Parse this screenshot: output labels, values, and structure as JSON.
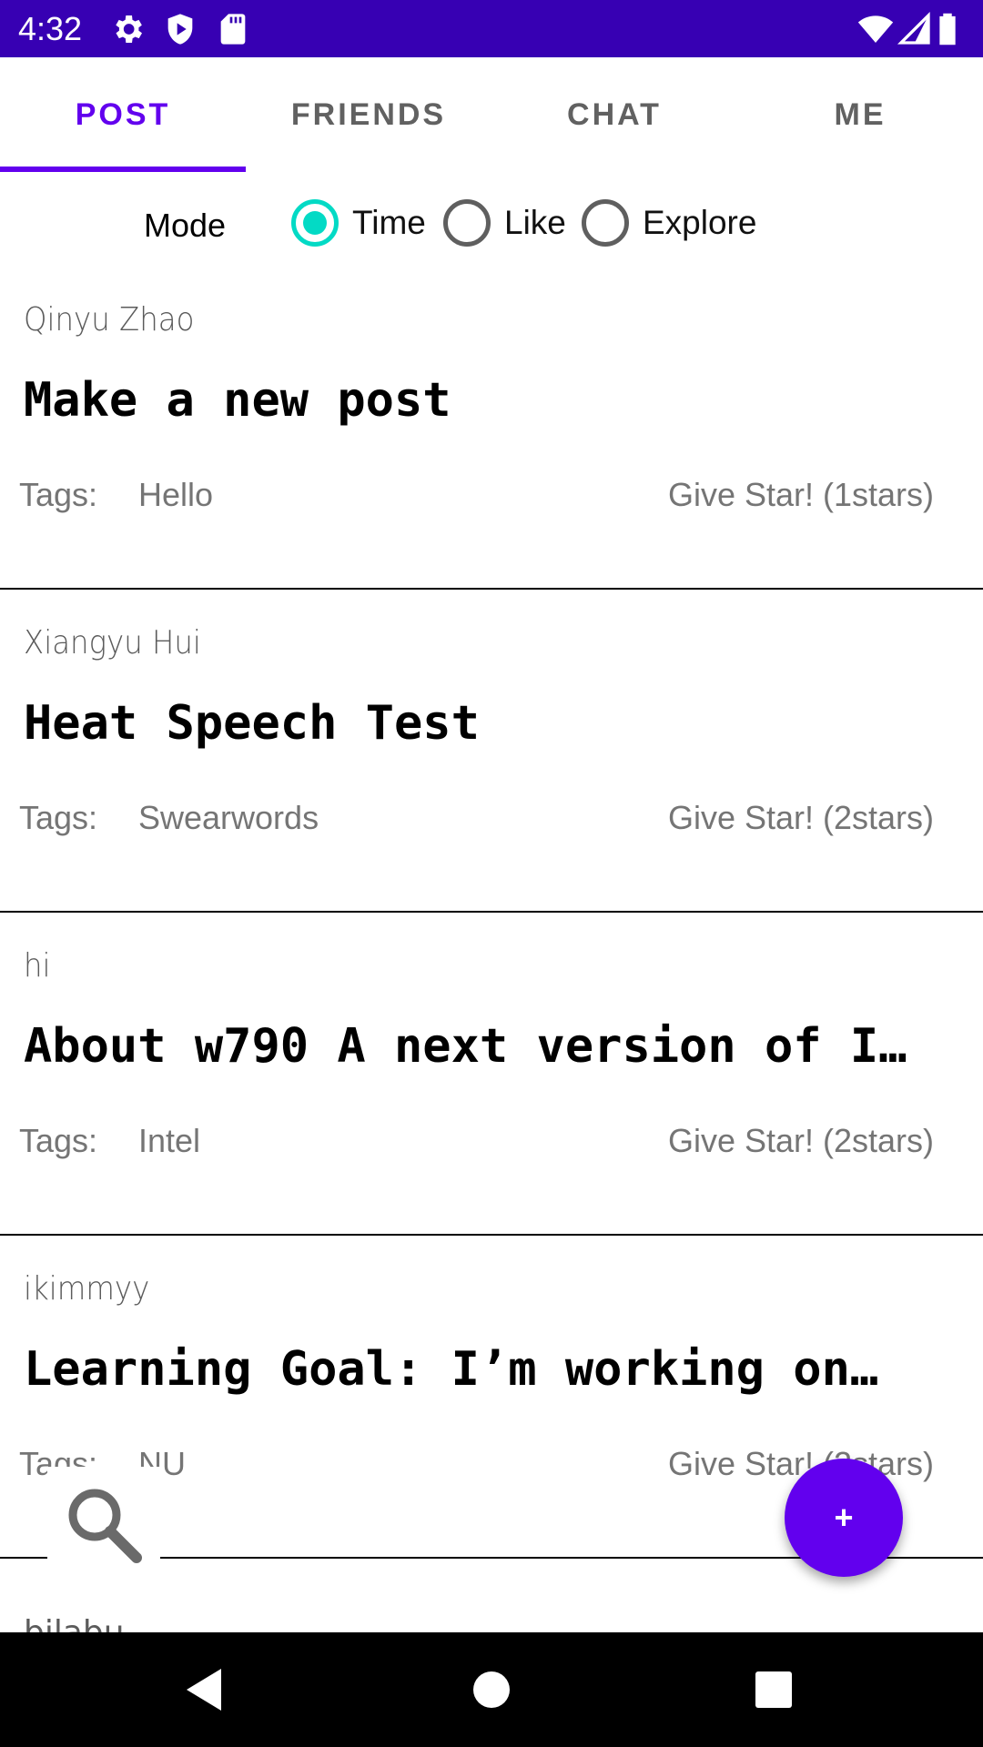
{
  "status_bar": {
    "time": "4:32",
    "icons": [
      "gear-icon",
      "shield-icon",
      "sd-card-icon",
      "wifi-icon",
      "signal-icon",
      "battery-icon"
    ]
  },
  "tabs": [
    {
      "label": "POST",
      "active": true
    },
    {
      "label": "FRIENDS",
      "active": false
    },
    {
      "label": "CHAT",
      "active": false
    },
    {
      "label": "ME",
      "active": false
    }
  ],
  "mode": {
    "label": "Mode",
    "options": [
      {
        "label": "Time",
        "checked": true
      },
      {
        "label": "Like",
        "checked": false
      },
      {
        "label": "Explore",
        "checked": false
      }
    ]
  },
  "posts": [
    {
      "author": "Qinyu Zhao",
      "title": "Make a new post",
      "tags_label": "Tags:",
      "tag": "Hello",
      "star": "Give Star! (1stars)"
    },
    {
      "author": "Xiangyu Hui",
      "title": "Heat Speech Test",
      "tags_label": "Tags:",
      "tag": "Swearwords",
      "star": "Give Star! (2stars)"
    },
    {
      "author": "hi",
      "title": "About w790 A next version of I…",
      "tags_label": "Tags:",
      "tag": "Intel",
      "star": "Give Star! (2stars)"
    },
    {
      "author": "ikimmyy",
      "title": "Learning Goal: I’m working on…",
      "tags_label": "Tags:",
      "tag": "NU",
      "star": "Give Star! (2stars)"
    }
  ],
  "partial_next_author": "bilabu",
  "fab": {
    "label": "+"
  },
  "colors": {
    "status_bar": "#3700b3",
    "accent": "#6200ee",
    "radio_checked": "#03dac5"
  },
  "nav": [
    "back-icon",
    "home-icon",
    "recents-icon"
  ]
}
